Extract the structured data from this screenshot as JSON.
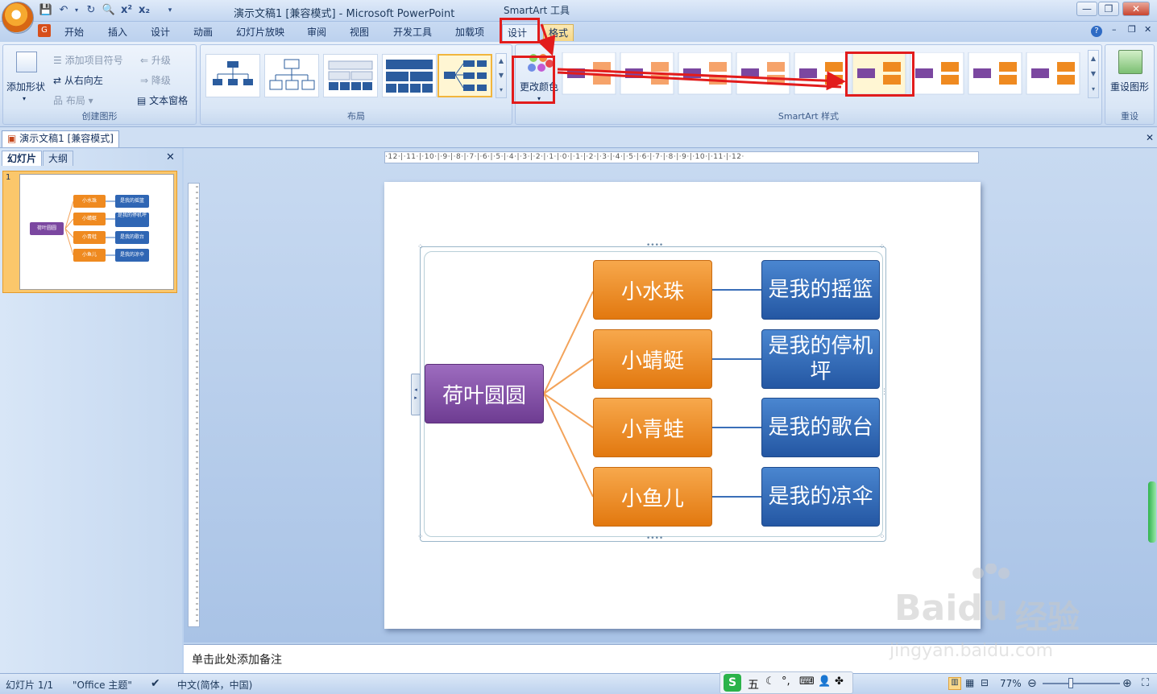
{
  "titlebar": {
    "doc_title": "演示文稿1 [兼容模式] - Microsoft PowerPoint",
    "context_title": "SmartArt 工具",
    "qat_icons": [
      "save-icon",
      "undo-icon",
      "redo-icon",
      "print-preview-icon",
      "superscript-icon",
      "subscript-icon"
    ],
    "window_buttons": [
      "—",
      "❐",
      "✕"
    ]
  },
  "tabs": [
    "开始",
    "插入",
    "设计",
    "动画",
    "幻灯片放映",
    "审阅",
    "视图",
    "开发工具",
    "加载项",
    "设计",
    "格式"
  ],
  "ribbon": {
    "create_group": {
      "label": "创建图形",
      "add_shape": "添加形状",
      "add_bullet": "添加项目符号",
      "rtl": "从右向左",
      "layout": "布局",
      "promote": "升级",
      "demote": "降级",
      "text_pane": "文本窗格"
    },
    "layout_group": {
      "label": "布局"
    },
    "style_group": {
      "label": "SmartArt 样式",
      "change_colors": "更改颜色"
    },
    "reset_group": {
      "label": "重设",
      "reset_graphic": "重设图形"
    }
  },
  "doc_tab": "演示文稿1 [兼容模式]",
  "left_panel": {
    "tab_slides": "幻灯片",
    "tab_outline": "大纲",
    "slide_number": "1"
  },
  "ruler_text": "·12·|·11·|·10·|·9·|·8·|·7·|·6·|·5·|·4·|·3·|·2·|·1·|·0·|·1·|·2·|·3·|·4·|·5·|·6·|·7·|·8·|·9·|·10·|·11·|·12·",
  "smartart": {
    "root": "荷叶圆圆",
    "children": [
      {
        "label": "小水珠",
        "leaf": "是我的摇篮"
      },
      {
        "label": "小蜻蜓",
        "leaf": "是我的停机坪"
      },
      {
        "label": "小青蛙",
        "leaf": "是我的歌台"
      },
      {
        "label": "小鱼儿",
        "leaf": "是我的凉伞"
      }
    ],
    "colors": {
      "root": "#7b47a0",
      "mid": "#ef8a20",
      "leaf": "#2f66b4",
      "connector_mid": "#f3a35a",
      "connector_leaf": "#3a6fb8"
    }
  },
  "notes_placeholder": "单击此处添加备注",
  "status": {
    "slide": "幻灯片 1/1",
    "theme": "\"Office 主题\"",
    "language": "中文(简体，中国)",
    "ime": "五",
    "zoom": "77%"
  },
  "watermark": {
    "brand": "Baidu",
    "cn": "经验",
    "url": "jingyan.baidu.com"
  }
}
